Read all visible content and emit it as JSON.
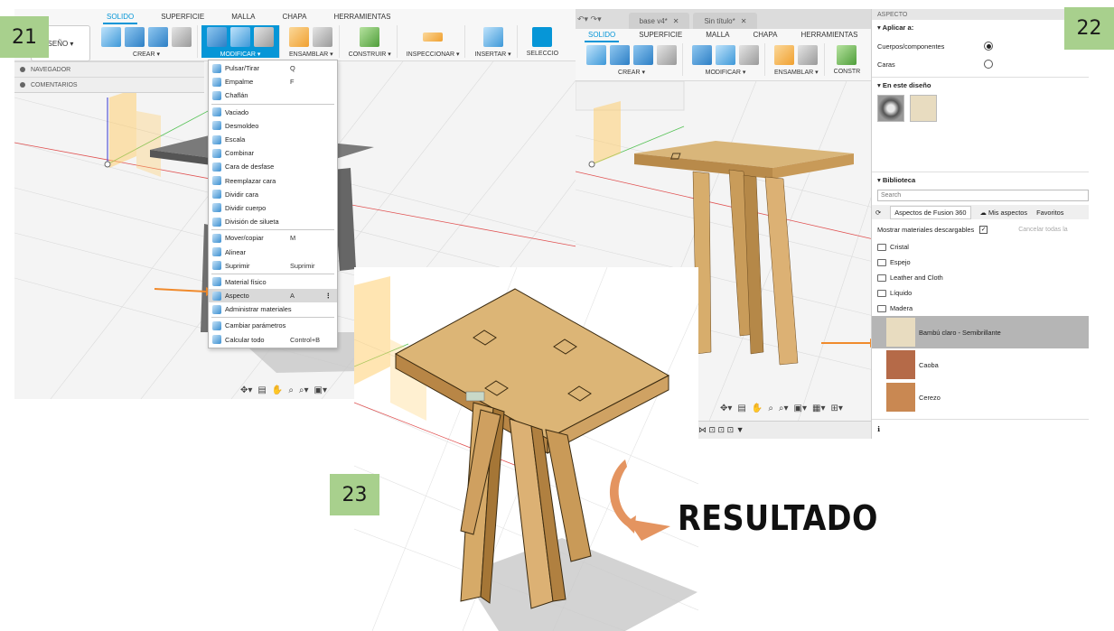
{
  "steps": {
    "s21": "21",
    "s22": "22",
    "s23": "23"
  },
  "result_label": "RESULTADO",
  "shot21": {
    "design_button": "SEÑO ▾",
    "tabs": [
      "SOLIDO",
      "SUPERFICIE",
      "MALLA",
      "CHAPA",
      "HERRAMIENTAS"
    ],
    "active_tab": "SOLIDO",
    "groups": [
      "CREAR ▾",
      "MODIFICAR ▾",
      "ENSAMBLAR ▾",
      "CONSTRUIR ▾",
      "INSPECCIONAR ▾",
      "INSERTAR ▾",
      "SELECCIO"
    ],
    "browser": [
      "NAVEGADOR",
      "COMENTARIOS"
    ],
    "menu": [
      {
        "label": "Pulsar/Tirar",
        "key": "Q"
      },
      {
        "label": "Empalme",
        "key": "F"
      },
      {
        "label": "Chaflán",
        "key": ""
      },
      {
        "sep": true
      },
      {
        "label": "Vaciado",
        "key": ""
      },
      {
        "label": "Desmoldeo",
        "key": ""
      },
      {
        "label": "Escala",
        "key": ""
      },
      {
        "label": "Combinar",
        "key": ""
      },
      {
        "label": "Cara de desfase",
        "key": ""
      },
      {
        "label": "Reemplazar cara",
        "key": ""
      },
      {
        "label": "Dividir cara",
        "key": ""
      },
      {
        "label": "Dividir cuerpo",
        "key": ""
      },
      {
        "label": "División de silueta",
        "key": ""
      },
      {
        "sep": true
      },
      {
        "label": "Mover/copiar",
        "key": "M"
      },
      {
        "label": "Alinear",
        "key": ""
      },
      {
        "label": "Suprimir",
        "key": "Suprimir"
      },
      {
        "sep": true
      },
      {
        "label": "Material físico",
        "key": ""
      },
      {
        "label": "Aspecto",
        "key": "A",
        "selected": true
      },
      {
        "label": "Administrar materiales",
        "key": ""
      },
      {
        "sep": true
      },
      {
        "label": "Cambiar parámetros",
        "key": ""
      },
      {
        "label": "Calcular todo",
        "key": "Control+B"
      }
    ]
  },
  "shot22": {
    "doc_tabs": [
      "base v4*",
      "Sin título*"
    ],
    "tabs": [
      "SOLIDO",
      "SUPERFICIE",
      "MALLA",
      "CHAPA",
      "HERRAMIENTAS"
    ],
    "groups": [
      "CREAR ▾",
      "MODIFICAR ▾",
      "ENSAMBLAR ▾",
      "CONSTR"
    ],
    "panel_title": "ASPECTO",
    "apply_to": "Aplicar a:",
    "opt_bodies": "Cuerpos/componentes",
    "opt_faces": "Caras",
    "in_design": "En este diseño",
    "library": "Biblioteca",
    "search_placeholder": "Search",
    "lib_tab_fusion": "Aspectos de Fusion 360",
    "lib_tab_mine": "Mis aspectos",
    "lib_tab_fav": "Favoritos",
    "show_downloadable": "Mostrar materiales descargables",
    "cancel_all": "Cancelar todas la",
    "folders": [
      "Cristal",
      "Espejo",
      "Leather and Cloth",
      "Líquido",
      "Madera"
    ],
    "materials": [
      {
        "name": "Bambú claro - Semibrillante",
        "color": "#e8dcc0",
        "selected": true
      },
      {
        "name": "Caoba",
        "color": "#b56a48"
      },
      {
        "name": "Cerezo",
        "color": "#c98852"
      }
    ],
    "colors": {
      "accent": "#0696d7",
      "arrow": "#f08a2c",
      "badge": "#a8d08d"
    }
  }
}
